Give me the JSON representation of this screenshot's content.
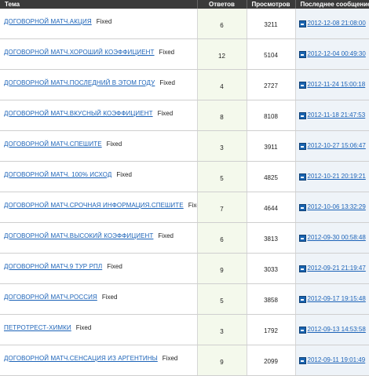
{
  "headers": {
    "topic": "Тема",
    "replies": "Ответов",
    "views": "Просмотров",
    "last_post": "Последнее сообщение"
  },
  "rows": [
    {
      "title": "ДОГОВОРНОЙ МАТЧ.АКЦИЯ",
      "tag": "Fixed",
      "replies": "6",
      "views": "3211",
      "last_date": "2012-12-08 21:08:00"
    },
    {
      "title": "ДОГОВОРНОЙ МАТЧ.ХОРОШИЙ КОЭФФИЦИЕНТ",
      "tag": "Fixed",
      "replies": "12",
      "views": "5104",
      "last_date": "2012-12-04 00:49:30"
    },
    {
      "title": "ДОГОВОРНОЙ МАТЧ.ПОСЛЕДНИЙ В ЭТОМ ГОДУ",
      "tag": "Fixed",
      "replies": "4",
      "views": "2727",
      "last_date": "2012-11-24 15:00:18"
    },
    {
      "title": "ДОГОВОРНОЙ МАТЧ.ВКУСНЫЙ КОЭФФИЦИЕНТ",
      "tag": "Fixed",
      "replies": "8",
      "views": "8108",
      "last_date": "2012-11-18 21:47:53"
    },
    {
      "title": "ДОГОВОРНОЙ МАТЧ.СПЕШИТЕ",
      "tag": "Fixed",
      "replies": "3",
      "views": "3911",
      "last_date": "2012-10-27 15:06:47"
    },
    {
      "title": "ДОГОВОРНОЙ МАТЧ. 100% ИСХОД",
      "tag": "Fixed",
      "replies": "5",
      "views": "4825",
      "last_date": "2012-10-21 20:19:21"
    },
    {
      "title": "ДОГОВОРНОЙ МАТЧ.СРОЧНАЯ ИНФОРМАЦИЯ.СПЕШИТЕ",
      "tag": "Fixed",
      "replies": "7",
      "views": "4644",
      "last_date": "2012-10-06 13:32:29"
    },
    {
      "title": "ДОГОВОРНОЙ МАТЧ.ВЫСОКИЙ КОЭФФИЦИЕНТ",
      "tag": "Fixed",
      "replies": "6",
      "views": "3813",
      "last_date": "2012-09-30 00:58:48"
    },
    {
      "title": "ДОГОВОРНОЙ МАТЧ.9 ТУР РПЛ",
      "tag": "Fixed",
      "replies": "9",
      "views": "3033",
      "last_date": "2012-09-21 21:19:47"
    },
    {
      "title": "ДОГОВОРНОЙ МАТЧ.РОССИЯ",
      "tag": "Fixed",
      "replies": "5",
      "views": "3858",
      "last_date": "2012-09-17 19:15:48"
    },
    {
      "title": "ПЕТРОТРЕСТ-ХИМКИ",
      "tag": "Fixed",
      "replies": "3",
      "views": "1792",
      "last_date": "2012-09-13 14:53:58"
    },
    {
      "title": "ДОГОВОРНОЙ МАТЧ.СЕНСАЦИЯ ИЗ АРГЕНТИНЫ",
      "tag": "Fixed",
      "replies": "9",
      "views": "2099",
      "last_date": "2012-09-11 19:01:49"
    }
  ],
  "icons": {
    "last_post": "post-icon"
  },
  "colors": {
    "header_bg": "#3a3a3a",
    "link": "#1c63b8",
    "replies_bg": "#f4f9ec",
    "last_bg": "#eef3f8"
  }
}
